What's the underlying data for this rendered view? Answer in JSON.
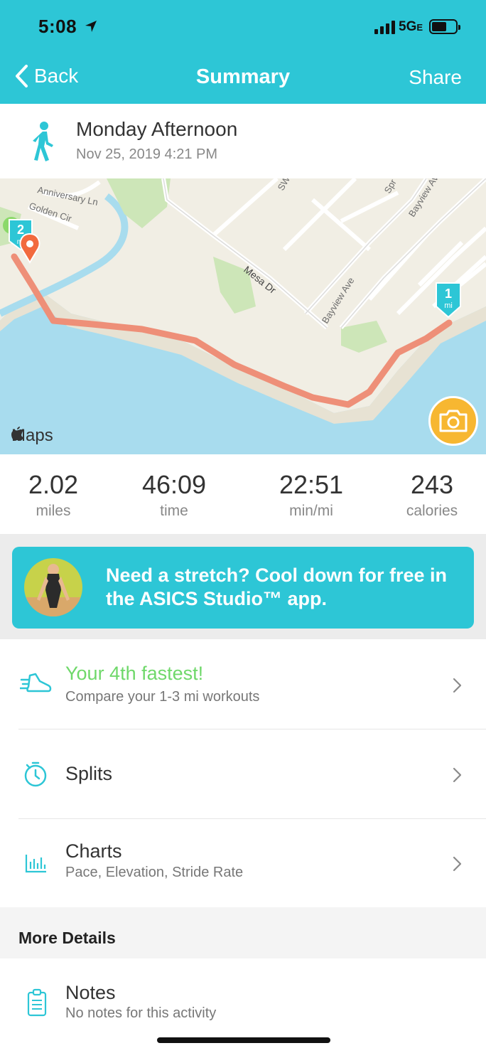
{
  "status_bar": {
    "time": "5:08",
    "network": "5G",
    "network_suffix": "E"
  },
  "nav": {
    "back_label": "Back",
    "title": "Summary",
    "share_label": "Share"
  },
  "activity": {
    "title": "Monday Afternoon",
    "date": "Nov 25, 2019 4:21 PM",
    "icon": "walking-person-icon"
  },
  "map": {
    "credit": "Maps",
    "street_labels": [
      "Anniversary Ln",
      "Golden Cir",
      "Mesa Dr",
      "Bayview Ave",
      "Bayview Ave",
      "SW",
      "Spr"
    ],
    "mile_markers": [
      {
        "number": "2",
        "unit": "mi"
      },
      {
        "number": "1",
        "unit": "mi"
      }
    ],
    "route_color": "#ee8f78",
    "camera_icon": "camera-icon"
  },
  "stats": [
    {
      "value": "2.02",
      "label": "miles"
    },
    {
      "value": "46:09",
      "label": "time"
    },
    {
      "value": "22:51",
      "label": "min/mi"
    },
    {
      "value": "243",
      "label": "calories"
    }
  ],
  "promo": {
    "text": "Need a stretch? Cool down for free in the ASICS Studio™ app."
  },
  "rows": {
    "fastest": {
      "title": "Your 4th fastest!",
      "subtitle": "Compare your 1-3 mi workouts",
      "icon": "running-shoe-icon"
    },
    "splits": {
      "title": "Splits",
      "icon": "stopwatch-icon"
    },
    "charts": {
      "title": "Charts",
      "subtitle": "Pace, Elevation, Stride Rate",
      "icon": "bar-chart-icon"
    },
    "notes": {
      "title": "Notes",
      "subtitle": "No notes for this activity",
      "icon": "clipboard-icon"
    }
  },
  "more_details": {
    "title": "More Details"
  },
  "colors": {
    "accent": "#2dc6d6",
    "highlight_green": "#6fd86a",
    "camera_button": "#f7b731"
  }
}
